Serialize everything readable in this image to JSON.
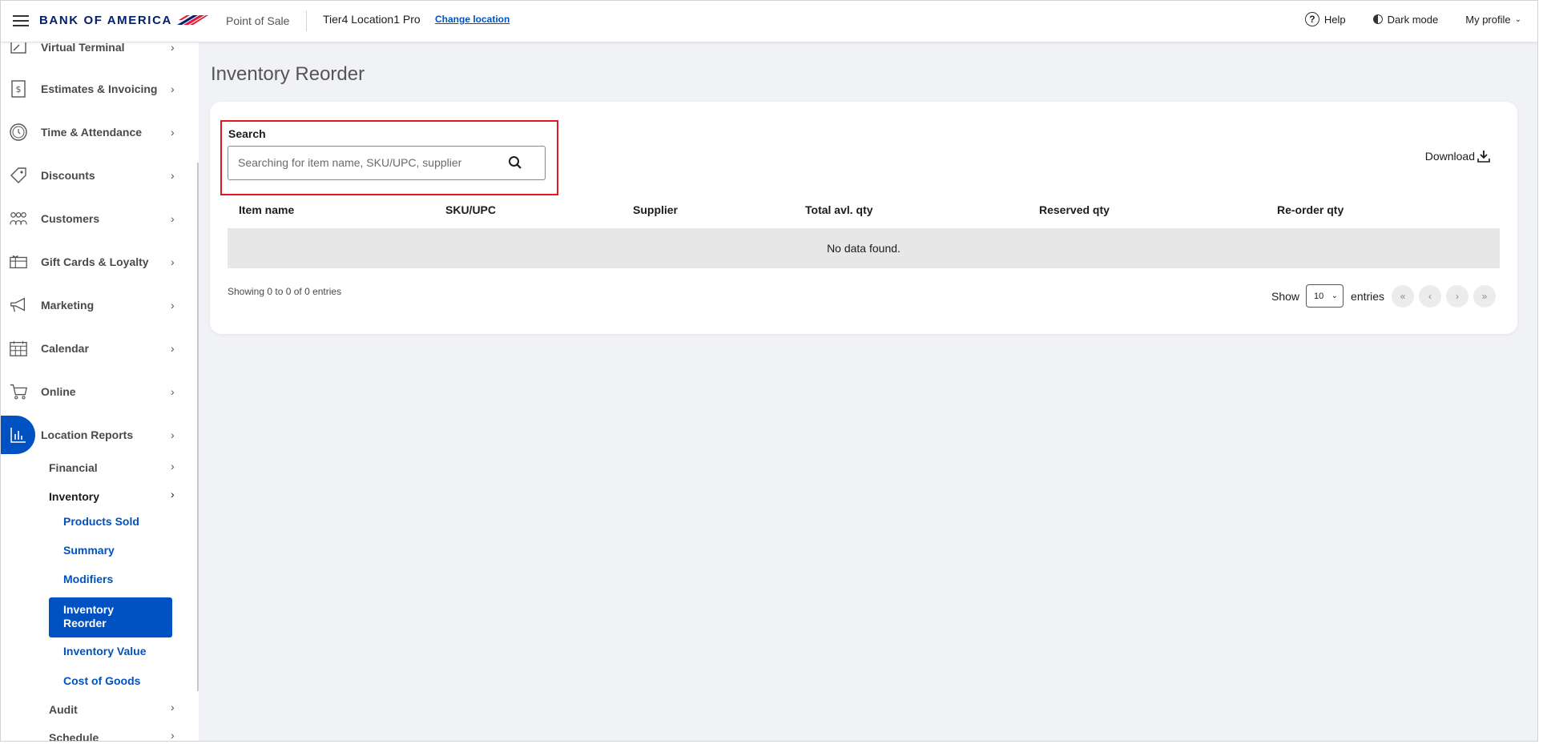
{
  "header": {
    "brand": "BANK OF AMERICA",
    "app_name": "Point of Sale",
    "location": "Tier4 Location1 Pro",
    "change_location": "Change location",
    "help": "Help",
    "dark_mode": "Dark mode",
    "profile": "My profile"
  },
  "sidebar": {
    "items": [
      {
        "label": "Virtual Terminal",
        "icon": "terminal-icon"
      },
      {
        "label": "Estimates & Invoicing",
        "icon": "invoice-icon"
      },
      {
        "label": "Time & Attendance",
        "icon": "clock-icon"
      },
      {
        "label": "Discounts",
        "icon": "tag-icon"
      },
      {
        "label": "Customers",
        "icon": "customers-icon"
      },
      {
        "label": "Gift Cards & Loyalty",
        "icon": "gift-card-icon"
      },
      {
        "label": "Marketing",
        "icon": "megaphone-icon"
      },
      {
        "label": "Calendar",
        "icon": "calendar-icon"
      },
      {
        "label": "Online",
        "icon": "cart-icon"
      },
      {
        "label": "Location Reports",
        "icon": "bar-chart-icon"
      }
    ],
    "reports_sub": {
      "financial": "Financial",
      "inventory": "Inventory",
      "inventory_items": [
        "Products Sold",
        "Summary",
        "Modifiers",
        "Inventory Reorder",
        "Inventory Value",
        "Cost of Goods"
      ],
      "audit": "Audit",
      "schedule": "Schedule"
    }
  },
  "main": {
    "title": "Inventory Reorder",
    "search_label": "Search",
    "search_placeholder": "Searching for item name, SKU/UPC, supplier",
    "download": "Download",
    "columns": [
      "Item name",
      "SKU/UPC",
      "Supplier",
      "Total avl. qty",
      "Reserved qty",
      "Re-order qty"
    ],
    "empty_message": "No data found.",
    "showing": "Showing 0 to 0 of 0 entries",
    "show_label": "Show",
    "entries_label": "entries",
    "page_size": "10",
    "pager": [
      "«",
      "‹",
      "›",
      "»"
    ]
  },
  "colors": {
    "brand_blue": "#0052c2",
    "logo_navy": "#012169",
    "logo_red": "#e31837",
    "highlight_red": "#e0171e"
  }
}
